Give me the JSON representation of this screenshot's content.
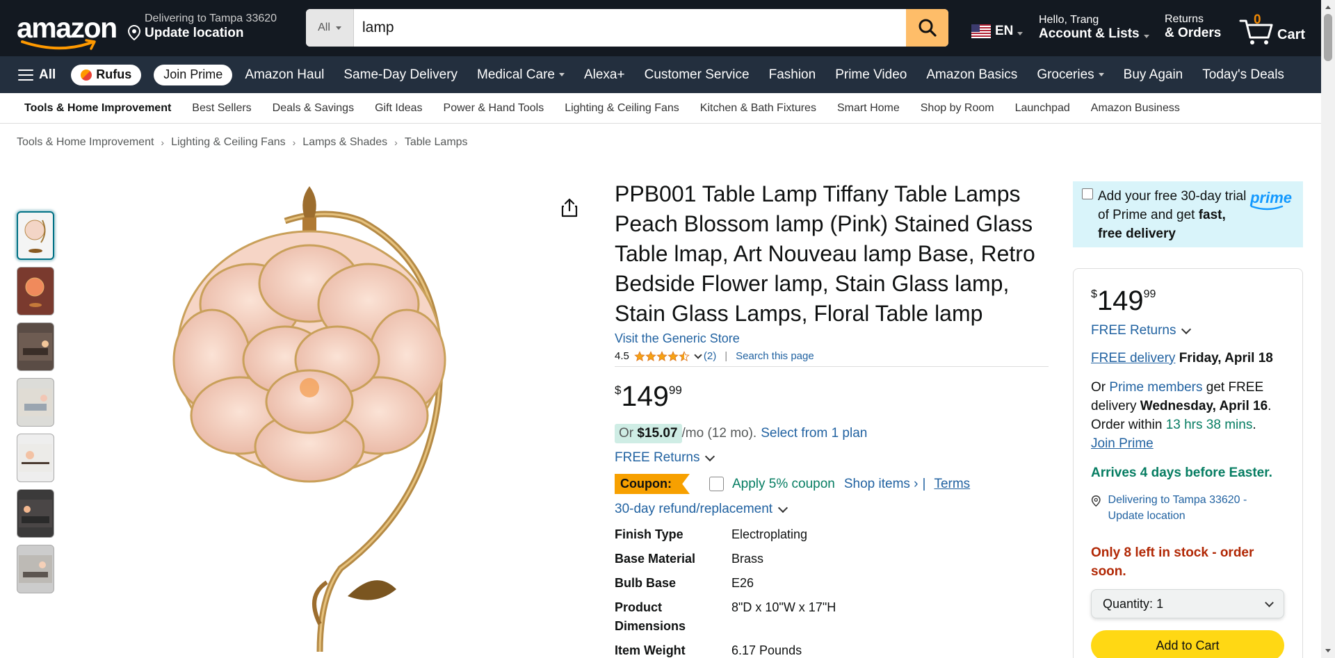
{
  "header": {
    "logo_text": "amazon",
    "deliver_line1": "Delivering to Tampa 33620",
    "deliver_line2": "Update location",
    "search_category": "All",
    "search_value": "lamp",
    "language": "EN",
    "account_line1": "Hello, Trang",
    "account_line2": "Account & Lists",
    "returns_line1": "Returns",
    "returns_line2": "& Orders",
    "cart_count": "0",
    "cart_label": "Cart"
  },
  "nav": {
    "all_label": "All",
    "rufus_label": "Rufus",
    "join_prime_label": "Join Prime",
    "items": [
      "Amazon Haul",
      "Same-Day Delivery",
      "Medical Care",
      "Alexa+",
      "Customer Service",
      "Fashion",
      "Prime Video",
      "Amazon Basics",
      "Groceries",
      "Buy Again",
      "Today's Deals"
    ]
  },
  "subnav": {
    "items": [
      "Tools & Home Improvement",
      "Best Sellers",
      "Deals & Savings",
      "Gift Ideas",
      "Power & Hand Tools",
      "Lighting & Ceiling Fans",
      "Kitchen & Bath Fixtures",
      "Smart Home",
      "Shop by Room",
      "Launchpad",
      "Amazon Business"
    ]
  },
  "breadcrumb": [
    "Tools & Home Improvement",
    "Lighting & Ceiling Fans",
    "Lamps & Shades",
    "Table Lamps"
  ],
  "product": {
    "title": "PPB001 Table Lamp Tiffany Table Lamps Peach Blossom lamp (Pink) Stained Glass Table lmap, Art Nouveau lamp Base, Retro Bedside Flower lamp, Stain Glass lamp, Stain Glass Lamps, Floral Table lamp",
    "store_link": "Visit the Generic Store",
    "rating": "4.5",
    "rating_value": 4.5,
    "review_count": "(2)",
    "search_page": "Search this page",
    "price_symbol": "$",
    "price_whole": "149",
    "price_fraction": "99",
    "plan_prefix": "Or",
    "plan_amount": "$15.07",
    "plan_suffix": "/mo (12 mo).",
    "plan_link": "Select from 1 plan",
    "free_returns": "FREE Returns",
    "coupon_badge": "Coupon:",
    "coupon_text": "Apply 5% coupon",
    "shop_items": "Shop items ›",
    "coupon_sep": "|",
    "terms": "Terms",
    "refund": "30-day refund/replacement",
    "specs": [
      {
        "k": "Finish Type",
        "v": "Electroplating"
      },
      {
        "k": "Base Material",
        "v": "Brass"
      },
      {
        "k": "Bulb Base",
        "v": "E26"
      },
      {
        "k": "Product Dimensions",
        "v": "8\"D x 10\"W x 17\"H"
      },
      {
        "k": "Item Weight",
        "v": "6.17 Pounds"
      }
    ]
  },
  "prime_box": {
    "line": "Add your free 30-day trial of Prime and get",
    "bold": "fast, free delivery",
    "logo": "prime"
  },
  "buybox": {
    "price_symbol": "$",
    "price_whole": "149",
    "price_fraction": "99",
    "free_returns": "FREE Returns",
    "free_delivery_link": "FREE delivery",
    "delivery_date": "Friday, April 18",
    "prime_or": "Or",
    "prime_members": "Prime members",
    "prime_get": "get FREE delivery",
    "prime_date": "Wednesday, April 16",
    "order_within": "Order within",
    "countdown": "13 hrs 38 mins",
    "join_prime": "Join Prime",
    "easter": "Arrives 4 days before Easter.",
    "location": "Delivering to Tampa 33620 - Update location",
    "stock": "Only 8 left in stock - order soon.",
    "qty_label": "Quantity:",
    "qty_value": "1",
    "add_to_cart": "Add to Cart"
  },
  "colors": {
    "nav_dark": "#131921",
    "nav_secondary": "#232F3E",
    "link": "#2162A1",
    "accent_orange": "#FF9900",
    "add_to_cart": "#FFD814",
    "stock_red": "#B12704",
    "green": "#067D62"
  }
}
